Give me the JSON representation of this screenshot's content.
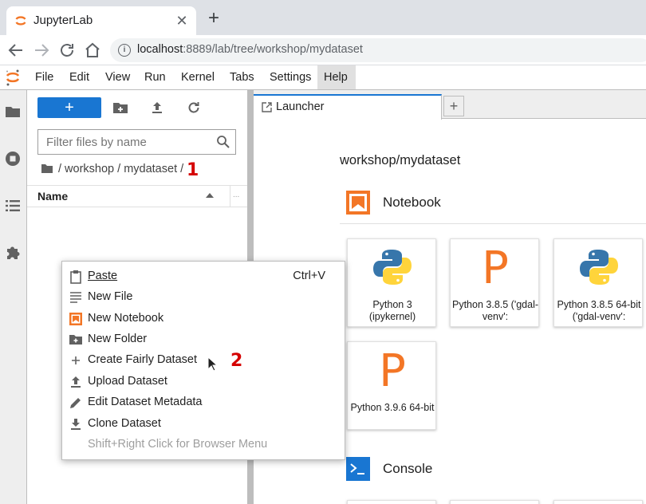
{
  "browser": {
    "tab_title": "JupyterLab",
    "tab_close": "✕",
    "new_tab": "+",
    "url_host": "localhost",
    "url_rest": ":8889/lab/tree/workshop/mydataset",
    "info_glyph": "i"
  },
  "menubar": {
    "items": [
      "File",
      "Edit",
      "View",
      "Run",
      "Kernel",
      "Tabs",
      "Settings",
      "Help"
    ],
    "active": "Help"
  },
  "activity_icons": [
    "folder-icon",
    "running-icon",
    "toc-icon",
    "extension-icon"
  ],
  "filebrowser": {
    "new_button": "+",
    "filter_placeholder": "Filter files by name",
    "breadcrumb": "/ workshop / mydataset /",
    "header_name": "Name",
    "header_more": "...",
    "annotation_1": "1"
  },
  "launcher": {
    "tab_label": "Launcher",
    "add_tab": "+",
    "cwd": "workshop/mydataset",
    "notebook_section": "Notebook",
    "console_section": "Console",
    "notebook_kernels": [
      {
        "label": "Python 3 (ipykernel)",
        "icon": "python-icon"
      },
      {
        "label": "Python 3.8.5 ('gdal-venv':",
        "icon": "p-letter-icon"
      },
      {
        "label": "Python 3.8.5 64-bit ('gdal-venv':",
        "icon": "python-icon"
      },
      {
        "label": "Python 3.9.6 64-bit",
        "icon": "p-letter-icon"
      }
    ]
  },
  "context_menu": {
    "items": [
      {
        "label": "Paste",
        "shortcut": "Ctrl+V",
        "icon": "paste-icon"
      },
      {
        "label": "New File",
        "shortcut": "",
        "icon": "text-file-icon"
      },
      {
        "label": "New Notebook",
        "shortcut": "",
        "icon": "notebook-icon"
      },
      {
        "label": "New Folder",
        "shortcut": "",
        "icon": "new-folder-icon"
      },
      {
        "label": "Create Fairly Dataset",
        "shortcut": "",
        "icon": "plus-icon"
      },
      {
        "label": "Upload Dataset",
        "shortcut": "",
        "icon": "upload-icon"
      },
      {
        "label": "Edit Dataset Metadata",
        "shortcut": "",
        "icon": "pencil-icon"
      },
      {
        "label": "Clone Dataset",
        "shortcut": "",
        "icon": "download-icon"
      },
      {
        "label": "Shift+Right Click for Browser Menu",
        "shortcut": "",
        "icon": ""
      }
    ],
    "annotation_2": "2"
  },
  "colors": {
    "accent": "#1976d2",
    "jupyter_orange": "#f37626",
    "annotation_red": "#d50000"
  }
}
